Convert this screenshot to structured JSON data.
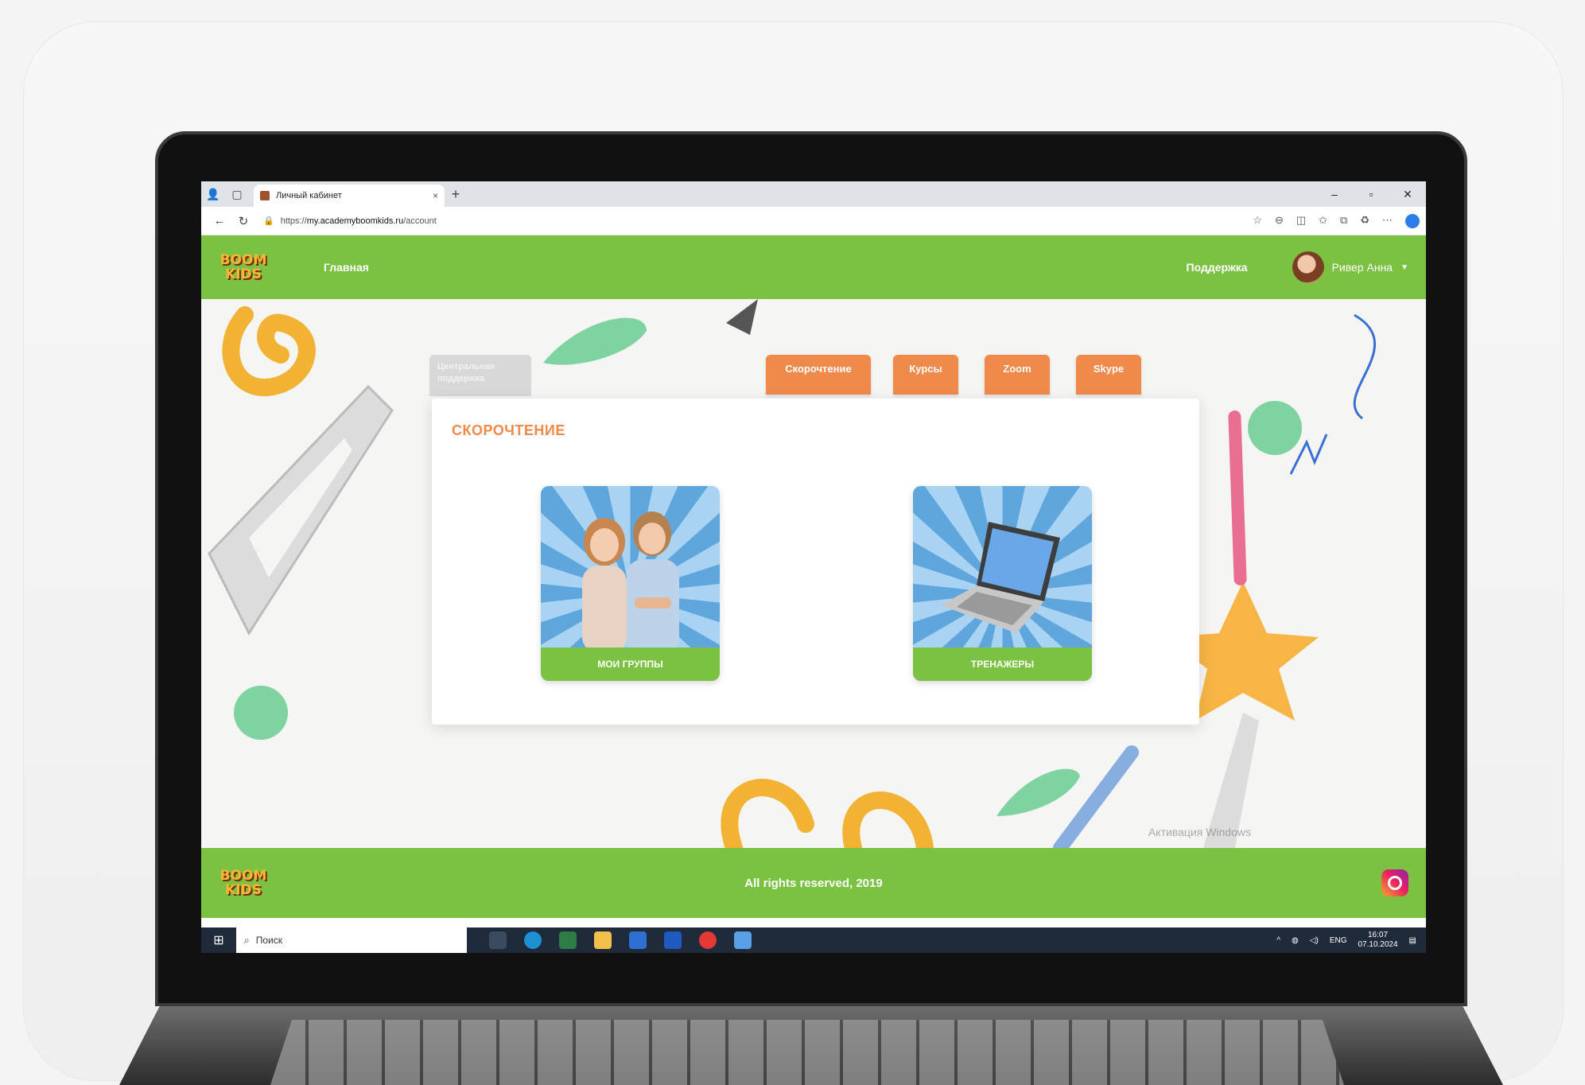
{
  "browser": {
    "tab_title": "Личный кабинет",
    "tab_close": "×",
    "new_tab": "+",
    "url_scheme": "https://",
    "url_host": "my.academyboomkids.ru",
    "url_path": "/account",
    "window_controls": [
      "–",
      "▫",
      "✕"
    ]
  },
  "site": {
    "logo_line1": "BOOM",
    "logo_line2": "KIDS",
    "nav_home": "Главная",
    "nav_support": "Поддержка",
    "user_name": "Ривер Анна",
    "grey_tab": "Центральная поддержка",
    "tabs": [
      "Скорочтение",
      "Курсы",
      "Zoom",
      "Skype"
    ],
    "panel_title": "СКОРОЧТЕНИЕ",
    "tiles": [
      {
        "label": "МОИ ГРУППЫ"
      },
      {
        "label": "ТРЕНАЖЕРЫ"
      }
    ],
    "footer_text": "All rights reserved, 2019",
    "activation_watermark": "Активация Windows"
  },
  "taskbar": {
    "search_placeholder": "Поиск",
    "lang": "ENG",
    "time": "16:07",
    "date": "07.10.2024"
  },
  "colors": {
    "brand_green": "#7cc242",
    "accent_orange": "#f08a4b"
  }
}
